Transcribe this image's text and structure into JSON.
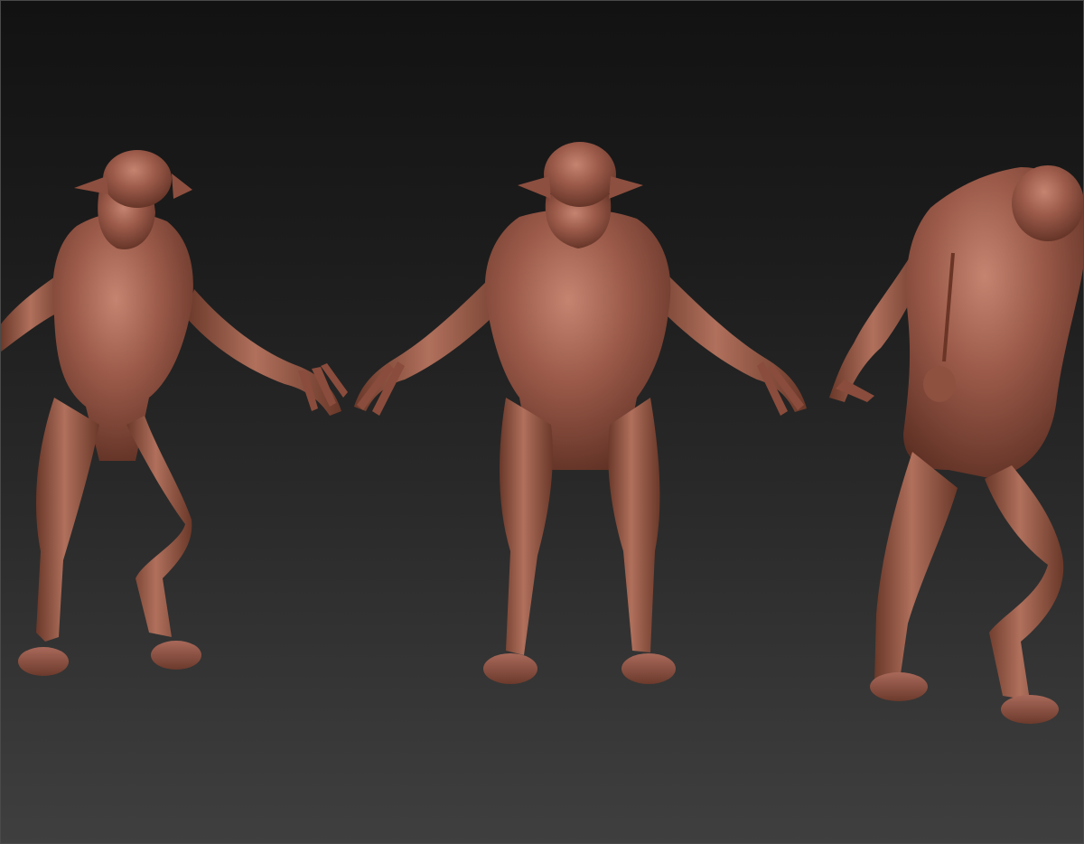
{
  "scene": {
    "background_top_color": "#121212",
    "background_bottom_color": "#3f3f3f",
    "material_color": "#9b5a49",
    "material_shadow_color": "#5e3024",
    "material_highlight_color": "#c48470",
    "views": [
      {
        "name": "front-three-quarter-view"
      },
      {
        "name": "front-view"
      },
      {
        "name": "back-three-quarter-view"
      }
    ]
  }
}
